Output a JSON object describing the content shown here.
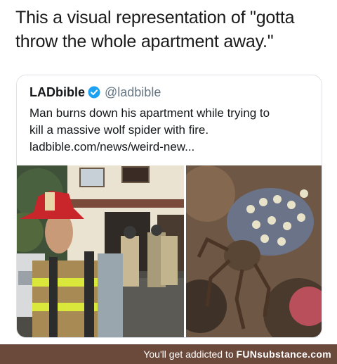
{
  "caption": {
    "line1": "This a visual representation of \"gotta",
    "line2": "throw the whole apartment away.\""
  },
  "tweet": {
    "name": "LADbible",
    "handle": "@ladbible",
    "text_line1": "Man burns down his apartment while trying to",
    "text_line2": "kill a massive wolf spider with fire.",
    "link": "ladbible.com/news/weird-new..."
  },
  "footer": {
    "prefix": "You'll get addicted to ",
    "brand": "FUNsubstance.com"
  },
  "colors": {
    "verified_badge": "#1da1f2",
    "footer_bg": "#6b4a3c"
  }
}
